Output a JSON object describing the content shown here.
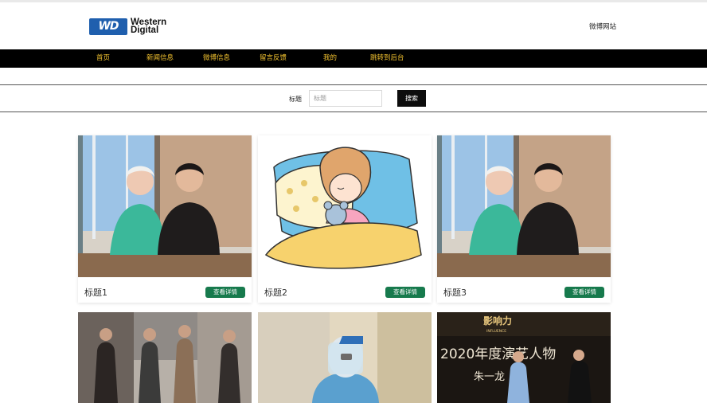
{
  "header": {
    "logo": {
      "badge": "WD",
      "line1": "Western",
      "line2": "Digital"
    },
    "weibo_link": "微博网站"
  },
  "nav": {
    "items": [
      {
        "label": "首页"
      },
      {
        "label": "新闻信息"
      },
      {
        "label": "微博信息"
      },
      {
        "label": "留言反馈"
      },
      {
        "label": "我的"
      },
      {
        "label": "跳转到后台"
      }
    ]
  },
  "search": {
    "label": "标题",
    "placeholder": "标题",
    "button_label": "搜索"
  },
  "cards": [
    {
      "title": "标题1",
      "button_label": "查看详情",
      "image": "couple-at-desk-photo"
    },
    {
      "title": "标题2",
      "button_label": "查看详情",
      "image": "sleeping-girl-cartoon"
    },
    {
      "title": "标题3",
      "button_label": "查看详情",
      "image": "couple-at-desk-photo"
    }
  ],
  "row2": {
    "cards": [
      {
        "image": "people-walking-street-photo"
      },
      {
        "image": "medical-worker-face-shield-photo"
      },
      {
        "image": "awards-stage-photo",
        "stage_text": "2020年度演艺人物",
        "stage_name": "朱一龙",
        "logo_text": "影响力",
        "logo_sub": "INFLUENCE"
      }
    ]
  },
  "colors": {
    "nav_bg": "#000000",
    "nav_text": "#f2c230",
    "detail_button": "#177a4d",
    "search_button": "#0d0d0d",
    "wd_blue": "#1f5fae"
  }
}
